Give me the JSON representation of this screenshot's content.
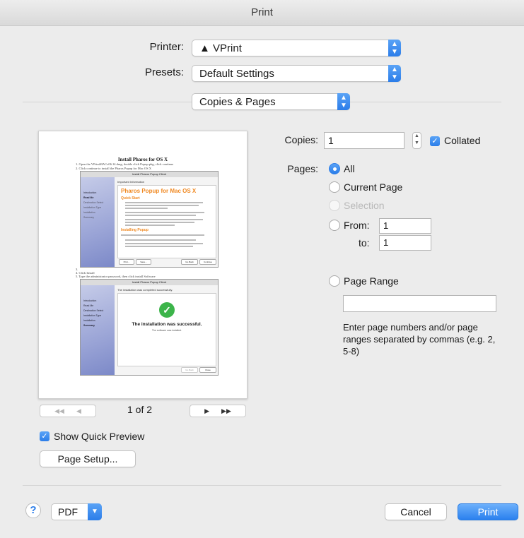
{
  "window": {
    "title": "Print"
  },
  "printer": {
    "label": "Printer:",
    "value": "▲ VPrint"
  },
  "presets": {
    "label": "Presets:",
    "value": "Default Settings"
  },
  "section": {
    "value": "Copies & Pages"
  },
  "copies": {
    "label": "Copies:",
    "value": "1",
    "collated_label": "Collated",
    "collated": true
  },
  "pages": {
    "label": "Pages:",
    "all_label": "All",
    "current_label": "Current Page",
    "selection_label": "Selection",
    "from_label": "From:",
    "from_value": "1",
    "to_label": "to:",
    "to_value": "1",
    "range_label": "Page Range",
    "range_value": "",
    "range_hint": "Enter page numbers and/or page ranges separated by commas (e.g. 2, 5-8)",
    "selected": "all"
  },
  "preview": {
    "doc_title": "Install Pharos for OS X",
    "steps": [
      "1.  Open the VPrintMACv06.14.dmg, double click Popup.pkg, click continue",
      "2.  Click continue to install the Pharos Popup for Mac OS X",
      "3.",
      "4.  Click Install",
      "5.  Type the administrator password, then click install Software"
    ],
    "shot1": {
      "title": "Install Pharos Popup Client",
      "header": "Important Information",
      "heading": "Pharos Popup for Mac OS X",
      "sub1": "Quick Start",
      "sub2": "Installing Popup",
      "sidebar": [
        "Introduction",
        "Read Me",
        "Destination Select",
        "Installation Type",
        "Installation",
        "Summary"
      ],
      "buttons": [
        "Print...",
        "Save...",
        "Go Back",
        "Continue"
      ]
    },
    "shot2": {
      "title": "Install Pharos Popup Client",
      "header": "The installation was completed successfully.",
      "success": "The installation was successful.",
      "success_sub": "The software was installed.",
      "sidebar": [
        "Introduction",
        "Read Me",
        "Destination Select",
        "Installation Type",
        "Installation",
        "Summary"
      ],
      "buttons": [
        "Go Back",
        "Close"
      ]
    },
    "page_indicator": "1 of 2",
    "first_icon": "◀◀",
    "prev_icon": "◀",
    "next_icon": "▶",
    "last_icon": "▶▶"
  },
  "quick_preview": {
    "label": "Show Quick Preview",
    "checked": true
  },
  "page_setup": {
    "label": "Page Setup..."
  },
  "footer": {
    "help": "?",
    "pdf": "PDF",
    "cancel": "Cancel",
    "print": "Print"
  },
  "colors": {
    "accent": "#2b7de9",
    "background": "#ececec"
  }
}
